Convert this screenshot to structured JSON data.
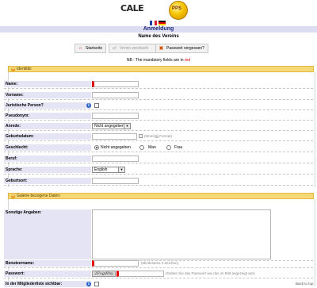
{
  "logo": {
    "text": "CALE",
    "ball_text": "PPS"
  },
  "header": {
    "title": "Anmeldung",
    "subtitle": "Name des Vereins"
  },
  "toolbar": {
    "home_label": "Startseite",
    "change_label": "Verein wechseln",
    "forgot_label": "Passwort vergessen?"
  },
  "notice": {
    "prefix": "NB : The mandatory fields are in ",
    "highlight": "red"
  },
  "identity": {
    "heading": "Identität:",
    "fields": {
      "name": "Name:",
      "vorname": "Vorname:",
      "juristische": "Juristische Person?",
      "pseudonym": "Pseudonym:",
      "anrede": "Anrede:",
      "geburtsdatum": "Geburtsdatum:",
      "geschlecht": "Geschlecht:",
      "beruf": "Beruf:",
      "sprache": "Sprache:",
      "geburtsort": "Geburtsort:"
    },
    "anrede_value": "Nicht angegeben",
    "date_hint": "(tt/mm/jjjj Format)",
    "gender_options": [
      "Nicht angegeben",
      "Man",
      "Frau"
    ],
    "sprache_value": "English"
  },
  "gallery": {
    "heading": "Galerie bezogene Daten:",
    "fields": {
      "sonstige": "Sonstige Angaben:",
      "benutzername": "Benutzername:",
      "passwort": "Passwort:",
      "sichtbar": "In der Mitgliederliste sichtbar:"
    },
    "username_hint": "(Mindestens 3 Zeichen)",
    "captcha_text": "2Fvgdlby",
    "captcha_hint": "(Geben Sie das Passwort wie das im Bild angezeigt wird"
  },
  "back_to_top": "Back to top",
  "colors": {
    "title_bar": "#dcdcf2",
    "section_header": "#f5d877",
    "required": "#e00000",
    "label_bg": "#e4e4f4"
  }
}
